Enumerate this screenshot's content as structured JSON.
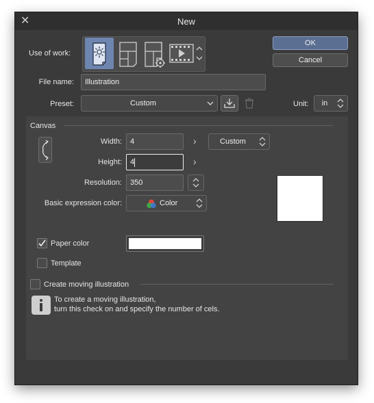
{
  "window": {
    "title": "New",
    "close_glyph": "✕"
  },
  "use_of_work": {
    "label": "Use of work:",
    "options": [
      {
        "name": "illustration",
        "icon": "illustration-icon",
        "selected": true
      },
      {
        "name": "comic",
        "icon": "comic-page-icon",
        "selected": false
      },
      {
        "name": "comic-settings",
        "icon": "comic-settings-icon",
        "selected": false
      },
      {
        "name": "animation",
        "icon": "animation-icon",
        "selected": false
      }
    ]
  },
  "file_name": {
    "label": "File name:",
    "value": "Illustration"
  },
  "preset": {
    "label": "Preset:",
    "value": "Custom"
  },
  "unit": {
    "label": "Unit:",
    "value": "in"
  },
  "buttons": {
    "ok": "OK",
    "cancel": "Cancel"
  },
  "canvas": {
    "section_label": "Canvas",
    "width": {
      "label": "Width:",
      "value": "4"
    },
    "height": {
      "label": "Height:",
      "value": "4"
    },
    "size_preset": "Custom",
    "resolution": {
      "label": "Resolution:",
      "value": "350"
    },
    "expression_color": {
      "label": "Basic expression color:",
      "value": "Color"
    },
    "paper_color": {
      "label": "Paper color",
      "checked": true,
      "color": "#ffffff"
    },
    "template": {
      "label": "Template",
      "checked": false
    }
  },
  "moving_illustration": {
    "label": "Create moving illustration",
    "checked": false,
    "info_line1": "To create a moving illustration,",
    "info_line2": "turn this check on and specify the number of cels."
  },
  "colors": {
    "accent": "#5b6f93",
    "dialog_bg": "#3a3a3a",
    "panel_bg": "#434343"
  }
}
